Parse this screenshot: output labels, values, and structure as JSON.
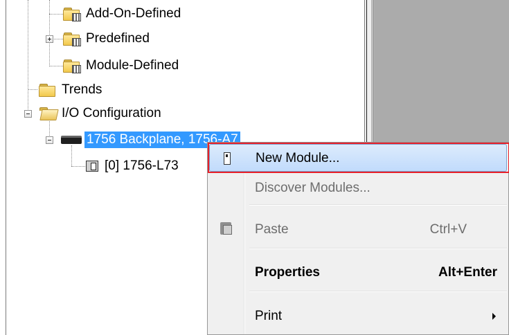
{
  "tree": {
    "items": [
      {
        "label": "Add-On-Defined",
        "icon": "folder-with-grid-icon"
      },
      {
        "label": "Predefined",
        "icon": "folder-with-grid-icon",
        "expander": "plus"
      },
      {
        "label": "Module-Defined",
        "icon": "folder-with-grid-icon"
      },
      {
        "label": "Trends",
        "icon": "folder-icon"
      },
      {
        "label": "I/O Configuration",
        "icon": "open-folder-icon",
        "expander": "minus"
      },
      {
        "label": "1756 Backplane, 1756-A7",
        "icon": "backplane-icon",
        "expander": "minus",
        "selected": true
      },
      {
        "label": "[0] 1756-L73",
        "icon": "controller-module-icon"
      }
    ]
  },
  "context_menu": {
    "items": [
      {
        "label": "New Module...",
        "icon": "new-module-icon",
        "state": "highlighted"
      },
      {
        "label": "Discover Modules...",
        "state": "disabled"
      },
      {
        "label": "Paste",
        "shortcut": "Ctrl+V",
        "icon": "paste-icon",
        "state": "disabled"
      },
      {
        "label": "Properties",
        "shortcut": "Alt+Enter",
        "state": "bold"
      },
      {
        "label": "Print",
        "submenu": true
      }
    ]
  },
  "colors": {
    "selection": "#3399ff",
    "menu_highlight": "#c1dbfc",
    "annotation_box": "#e8202a",
    "right_pane": "#ababab"
  }
}
